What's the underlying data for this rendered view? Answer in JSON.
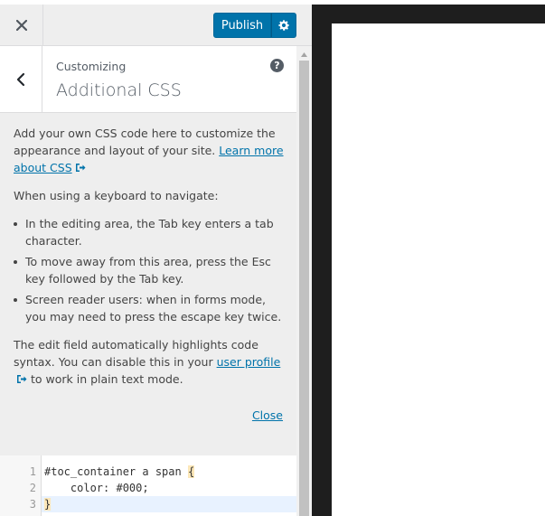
{
  "toolbar": {
    "publish_label": "Publish",
    "close_icon": "close-icon",
    "settings_icon": "gear-icon"
  },
  "panel": {
    "breadcrumb": "Customizing",
    "title": "Additional CSS",
    "help_icon": "help-icon"
  },
  "description": {
    "intro_text": "Add your own CSS code here to customize the appearance and layout of your site. ",
    "learn_more_link": "Learn more about CSS",
    "keyboard_heading": "When using a keyboard to navigate:",
    "bullets": [
      "In the editing area, the Tab key enters a tab character.",
      "To move away from this area, press the Esc key followed by the Tab key.",
      "Screen reader users: when in forms mode, you may need to press the escape key twice."
    ],
    "highlight_text_pre": "The edit field automatically highlights code syntax. You can disable this in your ",
    "user_profile_link": "user profile",
    "highlight_text_post": " to work in plain text mode.",
    "close_link": "Close"
  },
  "editor": {
    "line_numbers": [
      "1",
      "2",
      "3"
    ],
    "line1_selector": "#toc_container a span ",
    "line1_brace": "{",
    "line2": "    color: #000;",
    "line3_brace": "}"
  },
  "colors": {
    "accent": "#0073aa",
    "sidebar_bg": "#eeeeee",
    "preview_bg": "#ffffff",
    "frame_bg": "#1e1e1e"
  }
}
